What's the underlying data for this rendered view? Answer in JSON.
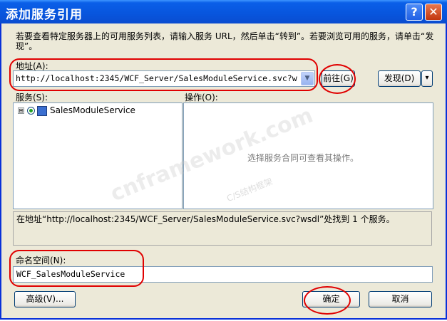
{
  "window": {
    "title": "添加服务引用",
    "help_glyph": "?",
    "close_glyph": "✕"
  },
  "description": "若要查看特定服务器上的可用服务列表，请输入服务 URL，然后单击“转到”。若要浏览可用的服务，请单击“发现”。",
  "address": {
    "label": "地址(A):",
    "value": "http://localhost:2345/WCF_Server/SalesModuleService.svc?w",
    "go_button": "前往(G)",
    "discover_button": "发现(D)",
    "discover_arrow": "▾"
  },
  "services": {
    "label": "服务(S):",
    "items": [
      {
        "label": "SalesModuleService",
        "expander": "⊞"
      }
    ]
  },
  "operations": {
    "label": "操作(O):",
    "placeholder": "选择服务合同可查看其操作。"
  },
  "status_text": "在地址“http://localhost:2345/WCF_Server/SalesModuleService.svc?wsdl”处找到 1 个服务。",
  "namespace": {
    "label": "命名空间(N):",
    "value": "WCF_SalesModuleService"
  },
  "buttons": {
    "advanced": "高级(V)...",
    "ok": "确定",
    "cancel": "取消"
  },
  "watermark": {
    "main": "cnframework.com",
    "sub": "C/S结构框架"
  },
  "colors": {
    "title_bar": "#0855dd",
    "window_bg": "#ece9d8",
    "annotation_red": "#e00000"
  }
}
